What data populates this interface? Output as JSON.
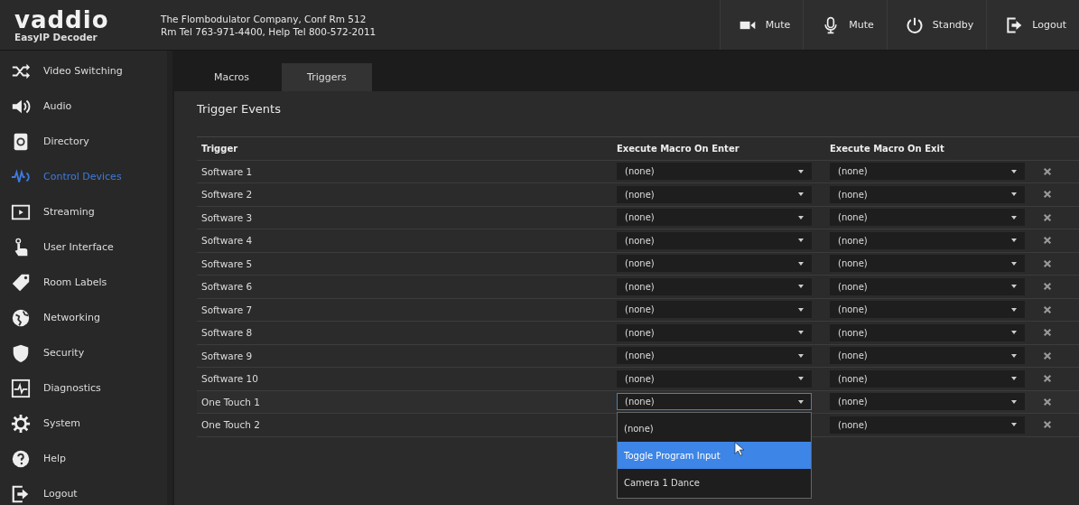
{
  "header": {
    "logo": "vaddio",
    "product": "EasyIP Decoder",
    "company": "The Flombodulator Company, Conf Rm 512",
    "contact": "Rm Tel 763-971-4400, Help Tel 800-572-2011",
    "buttons": [
      {
        "kind": "camera",
        "label": "Mute"
      },
      {
        "kind": "mic",
        "label": "Mute"
      },
      {
        "kind": "power",
        "label": "Standby"
      },
      {
        "kind": "logout",
        "label": "Logout"
      }
    ]
  },
  "sidebar": {
    "items": [
      {
        "label": "Video Switching",
        "selected": false
      },
      {
        "label": "Audio",
        "selected": false
      },
      {
        "label": "Directory",
        "selected": false
      },
      {
        "label": "Control Devices",
        "selected": true
      },
      {
        "label": "Streaming",
        "selected": false
      },
      {
        "label": "User Interface",
        "selected": false
      },
      {
        "label": "Room Labels",
        "selected": false
      },
      {
        "label": "Networking",
        "selected": false
      },
      {
        "label": "Security",
        "selected": false
      },
      {
        "label": "Diagnostics",
        "selected": false
      },
      {
        "label": "System",
        "selected": false
      },
      {
        "label": "Help",
        "selected": false
      },
      {
        "label": "Logout",
        "selected": false
      }
    ]
  },
  "tabs": [
    {
      "label": "Macros",
      "selected": false
    },
    {
      "label": "Triggers",
      "selected": true
    }
  ],
  "panel": {
    "title": "Trigger Events"
  },
  "table": {
    "columns": [
      "Trigger",
      "Execute Macro On Enter",
      "Execute Macro On Exit"
    ],
    "rows": [
      {
        "trigger": "Software 1",
        "on_enter": "(none)",
        "on_exit": "(none)",
        "enter_open": false
      },
      {
        "trigger": "Software 2",
        "on_enter": "(none)",
        "on_exit": "(none)",
        "enter_open": false
      },
      {
        "trigger": "Software 3",
        "on_enter": "(none)",
        "on_exit": "(none)",
        "enter_open": false
      },
      {
        "trigger": "Software 4",
        "on_enter": "(none)",
        "on_exit": "(none)",
        "enter_open": false
      },
      {
        "trigger": "Software 5",
        "on_enter": "(none)",
        "on_exit": "(none)",
        "enter_open": false
      },
      {
        "trigger": "Software 6",
        "on_enter": "(none)",
        "on_exit": "(none)",
        "enter_open": false
      },
      {
        "trigger": "Software 7",
        "on_enter": "(none)",
        "on_exit": "(none)",
        "enter_open": false
      },
      {
        "trigger": "Software 8",
        "on_enter": "(none)",
        "on_exit": "(none)",
        "enter_open": false
      },
      {
        "trigger": "Software 9",
        "on_enter": "(none)",
        "on_exit": "(none)",
        "enter_open": false
      },
      {
        "trigger": "Software 10",
        "on_enter": "(none)",
        "on_exit": "(none)",
        "enter_open": false
      },
      {
        "trigger": "One Touch 1",
        "on_enter": "(none)",
        "on_exit": "(none)",
        "enter_open": true
      },
      {
        "trigger": "One Touch 2",
        "on_exit": "(none)",
        "enter_open": false
      }
    ]
  },
  "dropdown_options": [
    {
      "label": "(none)",
      "selected": false
    },
    {
      "label": "Toggle Program Input",
      "selected": true
    },
    {
      "label": "Camera 1 Dance",
      "selected": false
    }
  ]
}
